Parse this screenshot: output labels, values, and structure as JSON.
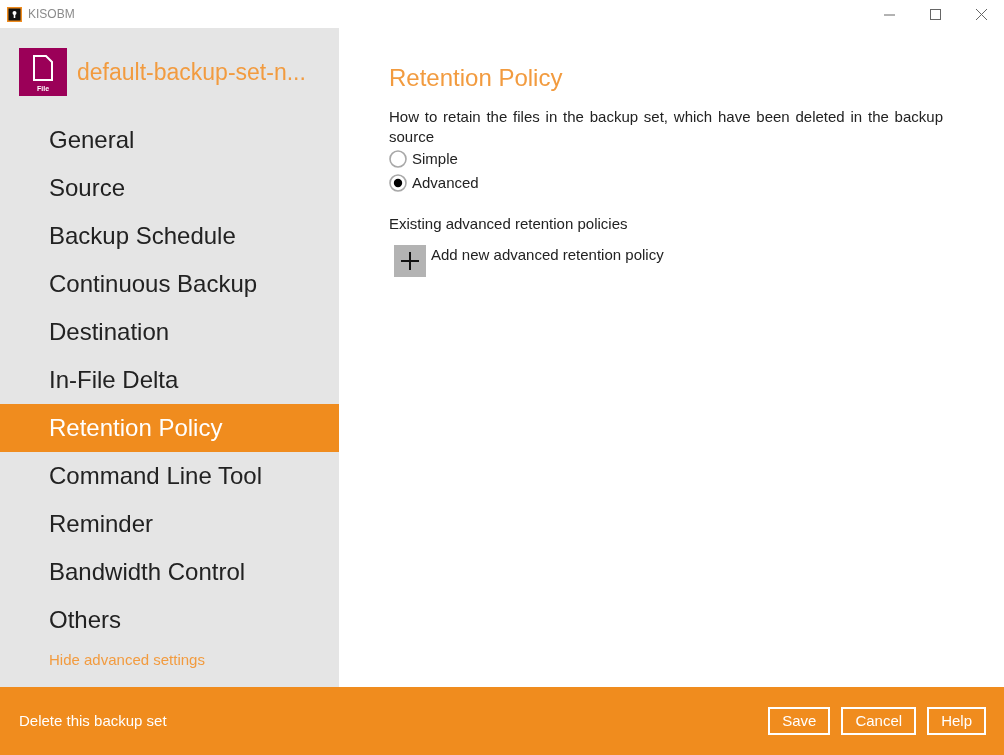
{
  "window": {
    "title": "KISOBM"
  },
  "backup_set": {
    "icon_label": "File",
    "name": "default-backup-set-n..."
  },
  "sidebar": {
    "items": [
      {
        "label": "General",
        "selected": false
      },
      {
        "label": "Source",
        "selected": false
      },
      {
        "label": "Backup Schedule",
        "selected": false
      },
      {
        "label": "Continuous Backup",
        "selected": false
      },
      {
        "label": "Destination",
        "selected": false
      },
      {
        "label": "In-File Delta",
        "selected": false
      },
      {
        "label": "Retention Policy",
        "selected": true
      },
      {
        "label": "Command Line Tool",
        "selected": false
      },
      {
        "label": "Reminder",
        "selected": false
      },
      {
        "label": "Bandwidth Control",
        "selected": false
      },
      {
        "label": "Others",
        "selected": false
      }
    ],
    "link": "Hide advanced settings"
  },
  "content": {
    "title": "Retention Policy",
    "description": "How to retain the files in the backup set, which have been deleted in the backup source",
    "options": [
      {
        "label": "Simple",
        "selected": false
      },
      {
        "label": "Advanced",
        "selected": true
      }
    ],
    "section_label": "Existing advanced retention policies",
    "add_label": "Add new advanced retention policy"
  },
  "footer": {
    "delete_link": "Delete this backup set",
    "buttons": [
      "Save",
      "Cancel",
      "Help"
    ]
  }
}
